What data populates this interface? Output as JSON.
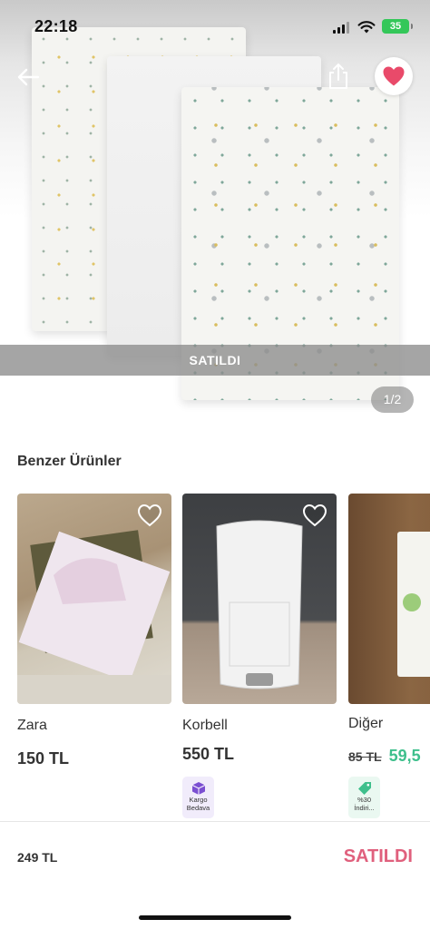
{
  "status_bar": {
    "time": "22:18",
    "battery": "35"
  },
  "hero": {
    "sold_label": "SATILDI",
    "page_indicator": "1/2",
    "favorite_active": true,
    "accent_color": "#e94a6a"
  },
  "similar": {
    "title": "Benzer Ürünler",
    "items": [
      {
        "brand": "Zara",
        "price": "150 TL",
        "liked": false
      },
      {
        "brand": "Korbell",
        "price": "550 TL",
        "liked": false,
        "badge": {
          "line1": "Kargo",
          "line2": "Bedava",
          "icon": "box-icon",
          "color": "#7b4fd1"
        }
      },
      {
        "brand": "Diğer",
        "old_price": "85 TL",
        "price": "59,5",
        "badge": {
          "line1": "%30",
          "line2": "İndiri...",
          "icon": "tag-icon",
          "color": "#3ebf8c"
        }
      }
    ]
  },
  "bottom_bar": {
    "price": "249 TL",
    "status": "SATILDI",
    "status_color": "#e0607d"
  }
}
